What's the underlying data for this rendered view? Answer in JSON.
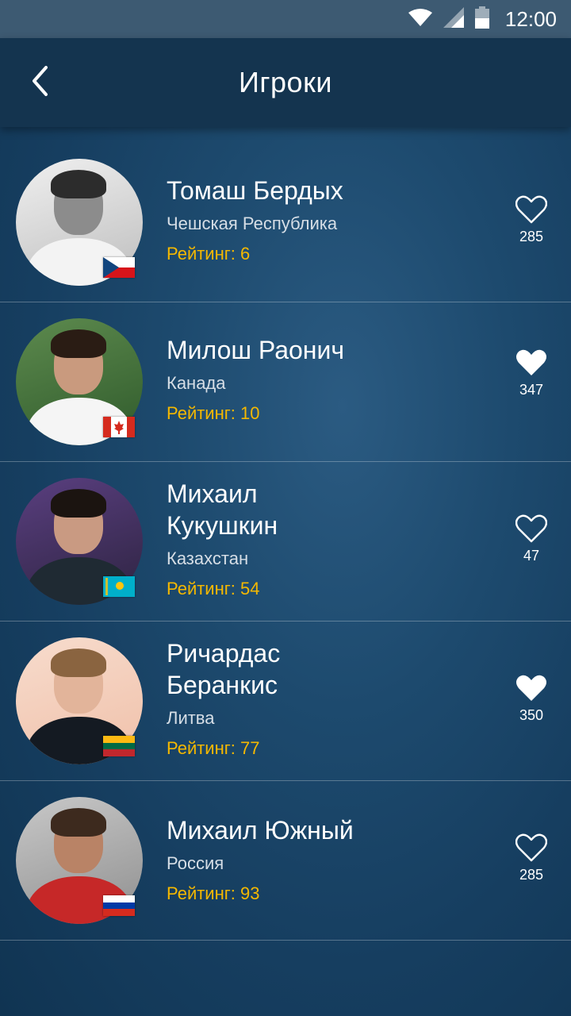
{
  "status_bar": {
    "time": "12:00",
    "icons": [
      "wifi-icon",
      "signal-icon",
      "battery-icon"
    ]
  },
  "header": {
    "title": "Игроки",
    "back_icon": "chevron-left-icon"
  },
  "players": [
    {
      "name": "Томаш Бердых",
      "country": "Чешская Республика",
      "rating": "Рейтинг: 6",
      "likes": "285",
      "liked": false,
      "flag": "czech"
    },
    {
      "name": "Милош Раонич",
      "country": "Канада",
      "rating": "Рейтинг: 10",
      "likes": "347",
      "liked": true,
      "flag": "canada"
    },
    {
      "name_lines": [
        "Михаил",
        "Кукушкин"
      ],
      "country": "Казахстан",
      "rating": "Рейтинг: 54",
      "likes": "47",
      "liked": false,
      "flag": "kazakhstan"
    },
    {
      "name_lines": [
        "Ричардас",
        "Беранкис"
      ],
      "country": "Литва",
      "rating": "Рейтинг: 77",
      "likes": "350",
      "liked": true,
      "flag": "lithuania"
    },
    {
      "name": "Михаил Южный",
      "country": "Россия",
      "rating": "Рейтинг: 93",
      "likes": "285",
      "liked": false,
      "flag": "russia"
    }
  ],
  "colors": {
    "rating": "#f5b800",
    "appbar": "#14344f",
    "statusbar": "#3d5a72"
  }
}
